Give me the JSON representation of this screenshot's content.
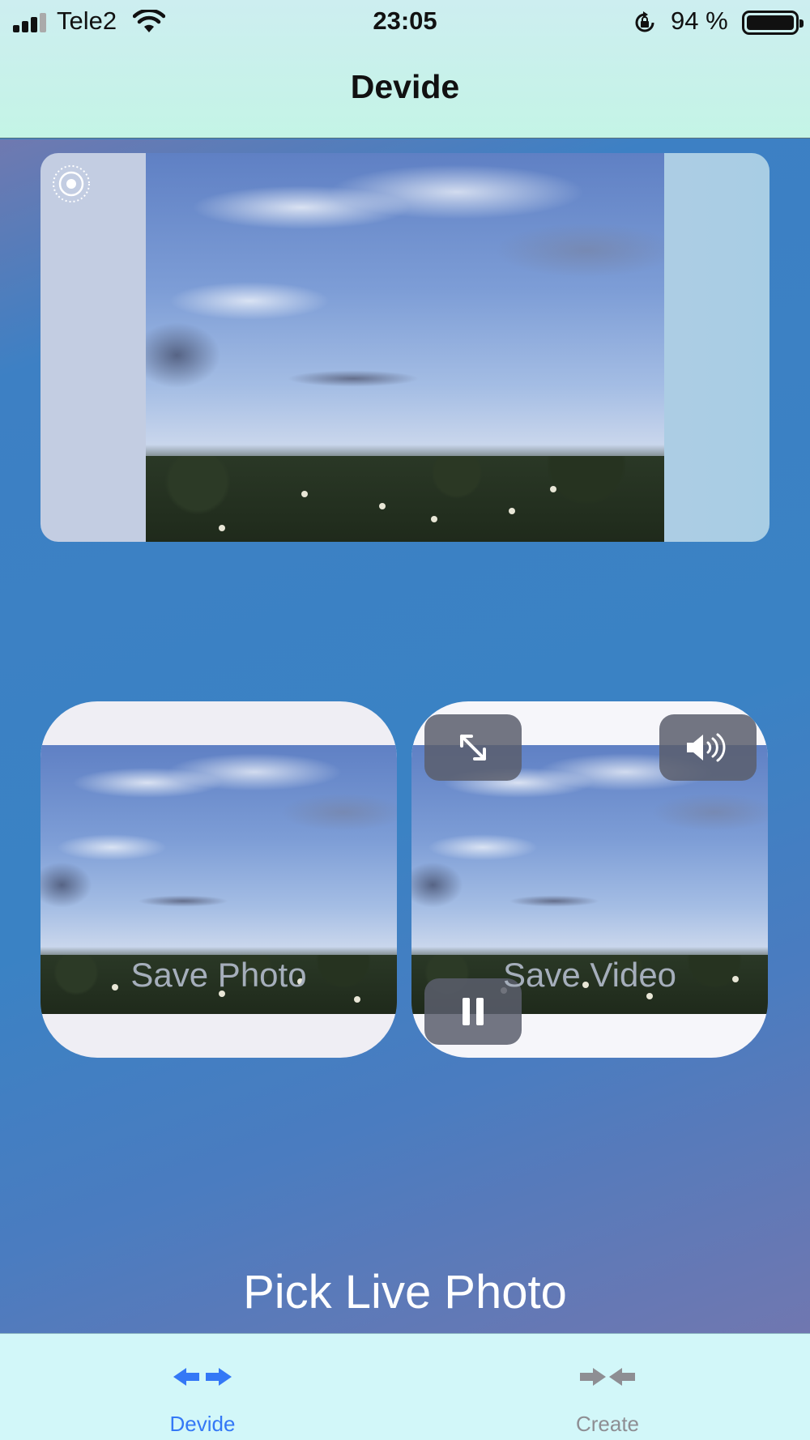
{
  "status_bar": {
    "carrier": "Tele2",
    "time": "23:05",
    "battery_percent": "94 %",
    "battery_level": 0.94,
    "icons": [
      "signal-icon",
      "wifi-icon",
      "rotation-lock-icon",
      "battery-icon"
    ]
  },
  "nav": {
    "title": "Devide"
  },
  "live_photo": {
    "badge_icon": "live-photo-icon"
  },
  "video_controls": {
    "fullscreen_icon": "expand-icon",
    "sound_icon": "speaker-icon",
    "pause_icon": "pause-icon"
  },
  "actions": {
    "save_photo": "Save Photo",
    "save_video": "Save Video",
    "pick_live_photo": "Pick Live Photo"
  },
  "tabs": [
    {
      "label": "Devide",
      "icon": "arrows-apart-icon",
      "selected": true,
      "color": "#3478f6"
    },
    {
      "label": "Create",
      "icon": "arrows-together-icon",
      "selected": false,
      "color": "#8e8e93"
    }
  ]
}
